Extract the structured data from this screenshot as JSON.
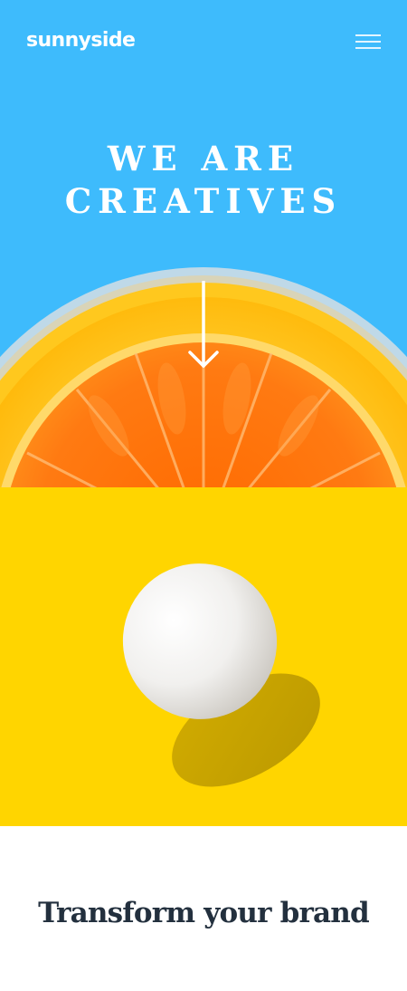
{
  "header": {
    "logo": "sunnyside",
    "menu_icon": "hamburger-menu-icon"
  },
  "hero": {
    "title_line1": "WE ARE",
    "title_line2": "CREATIVES",
    "arrow_icon": "arrow-down-icon",
    "background_color": "#3EBBFC",
    "image_subject": "orange-half"
  },
  "feature_image": {
    "subject": "egg",
    "background_color": "#FFD500"
  },
  "transform": {
    "title": "Transform your brand"
  },
  "colors": {
    "accent_blue": "#3EBBFC",
    "accent_yellow": "#FFD500",
    "heading_dark": "#23303E"
  }
}
